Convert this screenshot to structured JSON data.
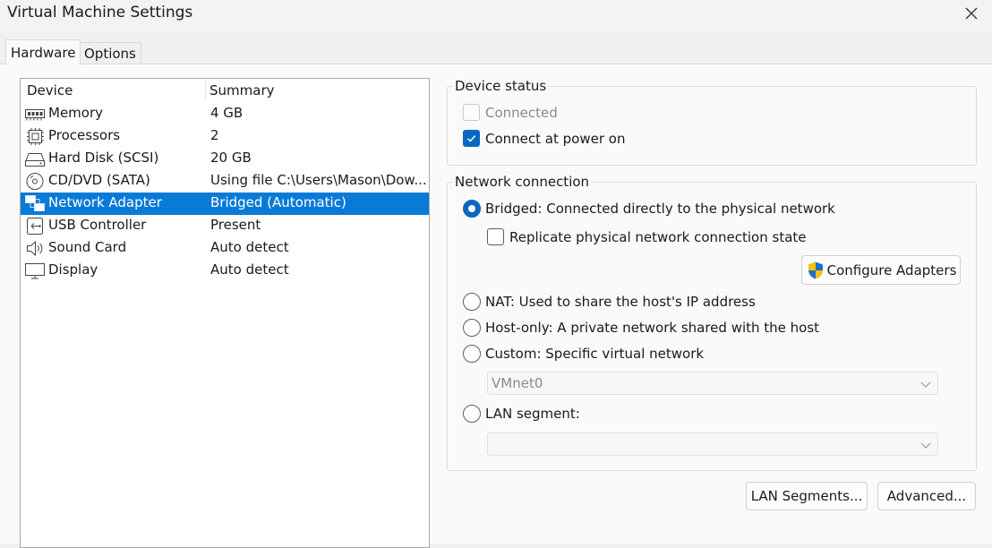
{
  "window": {
    "title": "Virtual Machine Settings"
  },
  "tabs": [
    {
      "label": "Hardware",
      "active": true
    },
    {
      "label": "Options",
      "active": false
    }
  ],
  "device_list": {
    "headers": {
      "device": "Device",
      "summary": "Summary"
    },
    "rows": [
      {
        "device": "Memory",
        "summary": "4 GB",
        "icon": "memory-icon",
        "selected": false
      },
      {
        "device": "Processors",
        "summary": "2",
        "icon": "processor-icon",
        "selected": false
      },
      {
        "device": "Hard Disk (SCSI)",
        "summary": "20 GB",
        "icon": "hard-disk-icon",
        "selected": false
      },
      {
        "device": "CD/DVD (SATA)",
        "summary": "Using file C:\\Users\\Mason\\Dow...",
        "icon": "cd-dvd-icon",
        "selected": false
      },
      {
        "device": "Network Adapter",
        "summary": "Bridged (Automatic)",
        "icon": "network-adapter-icon",
        "selected": true
      },
      {
        "device": "USB Controller",
        "summary": "Present",
        "icon": "usb-icon",
        "selected": false
      },
      {
        "device": "Sound Card",
        "summary": "Auto detect",
        "icon": "speaker-icon",
        "selected": false
      },
      {
        "device": "Display",
        "summary": "Auto detect",
        "icon": "monitor-icon",
        "selected": false
      }
    ]
  },
  "device_status": {
    "legend": "Device status",
    "connected": {
      "label": "Connected",
      "checked": false,
      "enabled": false
    },
    "connect_at_power_on": {
      "label": "Connect at power on",
      "checked": true,
      "enabled": true
    }
  },
  "network_connection": {
    "legend": "Network connection",
    "bridged": {
      "label": "Bridged: Connected directly to the physical network",
      "selected": true
    },
    "replicate": {
      "label": "Replicate physical network connection state",
      "checked": false
    },
    "configure_adapters": "Configure Adapters",
    "nat": {
      "label": "NAT: Used to share the host's IP address",
      "selected": false
    },
    "host_only": {
      "label": "Host-only: A private network shared with the host",
      "selected": false
    },
    "custom": {
      "label": "Custom: Specific virtual network",
      "selected": false
    },
    "custom_network_value": "VMnet0",
    "lan_segment": {
      "label": "LAN segment:",
      "selected": false
    },
    "lan_segment_value": ""
  },
  "buttons": {
    "lan_segments": "LAN Segments...",
    "advanced": "Advanced..."
  },
  "colors": {
    "selection": "#0a7ad7",
    "accent": "#0a67c2",
    "shield_blue": "#1f6fd1",
    "shield_yellow": "#f5c400"
  }
}
